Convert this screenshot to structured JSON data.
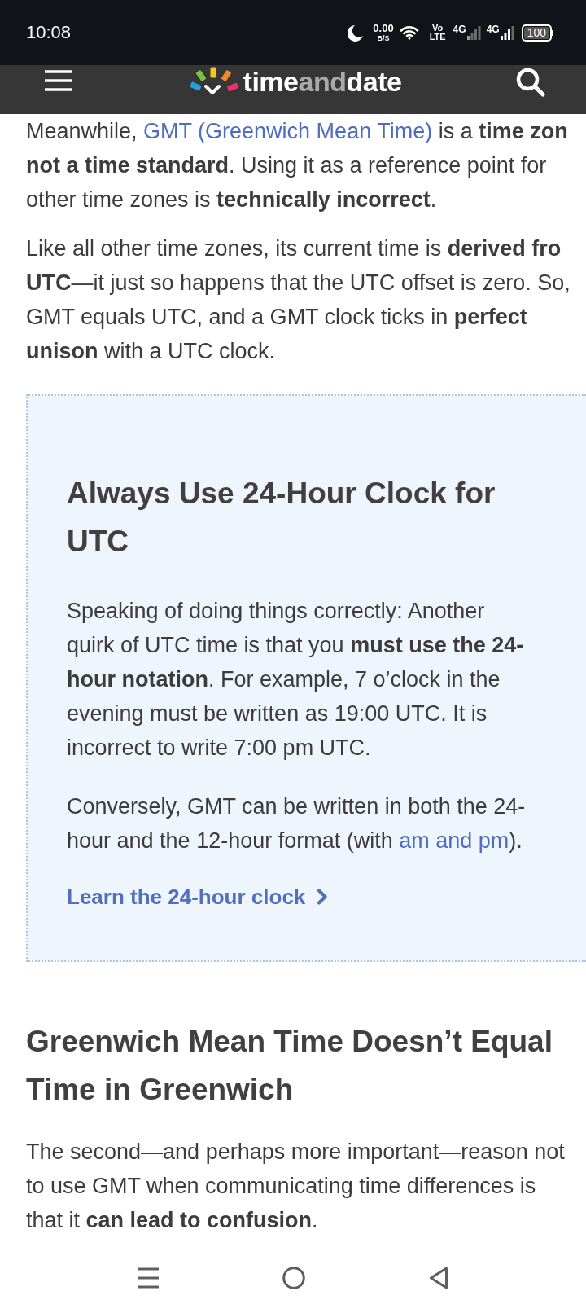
{
  "status_bar": {
    "time": "10:08",
    "speed_value": "0.00",
    "speed_unit": "B/S",
    "volte": [
      "Vo",
      "LTE"
    ],
    "sims": [
      "4G",
      "4G"
    ],
    "battery": "100"
  },
  "header": {
    "logo": [
      {
        "text": "time",
        "dim": false
      },
      {
        "text": "and",
        "dim": true
      },
      {
        "text": "date",
        "dim": false
      }
    ]
  },
  "article": [
    {
      "kind": "paragraph",
      "parts": [
        {
          "kind": "text",
          "text": "Meanwhile, "
        },
        {
          "kind": "link",
          "text": "GMT (Greenwich Mean Time)"
        },
        {
          "kind": "text",
          "text": " is a **time zon not a time standard**. Using it as a reference point for other time zones is **technically incorrect**."
        }
      ]
    },
    {
      "kind": "paragraph",
      "parts": [
        {
          "kind": "text",
          "text": "Like all other time zones, its current time is **derived fro UTC**—it just so happens that the UTC offset is zero. So, GMT equals UTC, and a GMT clock ticks in **perfect unison** with a UTC clock."
        }
      ]
    },
    {
      "kind": "callout",
      "heading": "Always Use 24-Hour Clock for UTC",
      "paragraphs": [
        [
          {
            "kind": "text",
            "text": "Speaking of doing things correctly: Another quirk of UTC time is that you **must use the 24-hour notation**. For example, 7 o’clock in the evening must be written as 19:00 UTC. It is incorrect to write 7:00 pm UTC."
          }
        ],
        [
          {
            "kind": "text",
            "text": "Conversely, GMT can be written in both the 24-hour and the 12-hour format (with "
          },
          {
            "kind": "link",
            "text": "am and pm"
          },
          {
            "kind": "text",
            "text": ")."
          }
        ]
      ],
      "link": "Learn the 24-hour clock"
    },
    {
      "kind": "heading",
      "text": "Greenwich Mean Time Doesn’t Equal Time in Greenwich"
    },
    {
      "kind": "paragraph",
      "parts": [
        {
          "kind": "text",
          "text": "The second—and perhaps more important—reason not to use GMT when communicating time differences is that it **can lead to confusion**."
        }
      ]
    }
  ]
}
